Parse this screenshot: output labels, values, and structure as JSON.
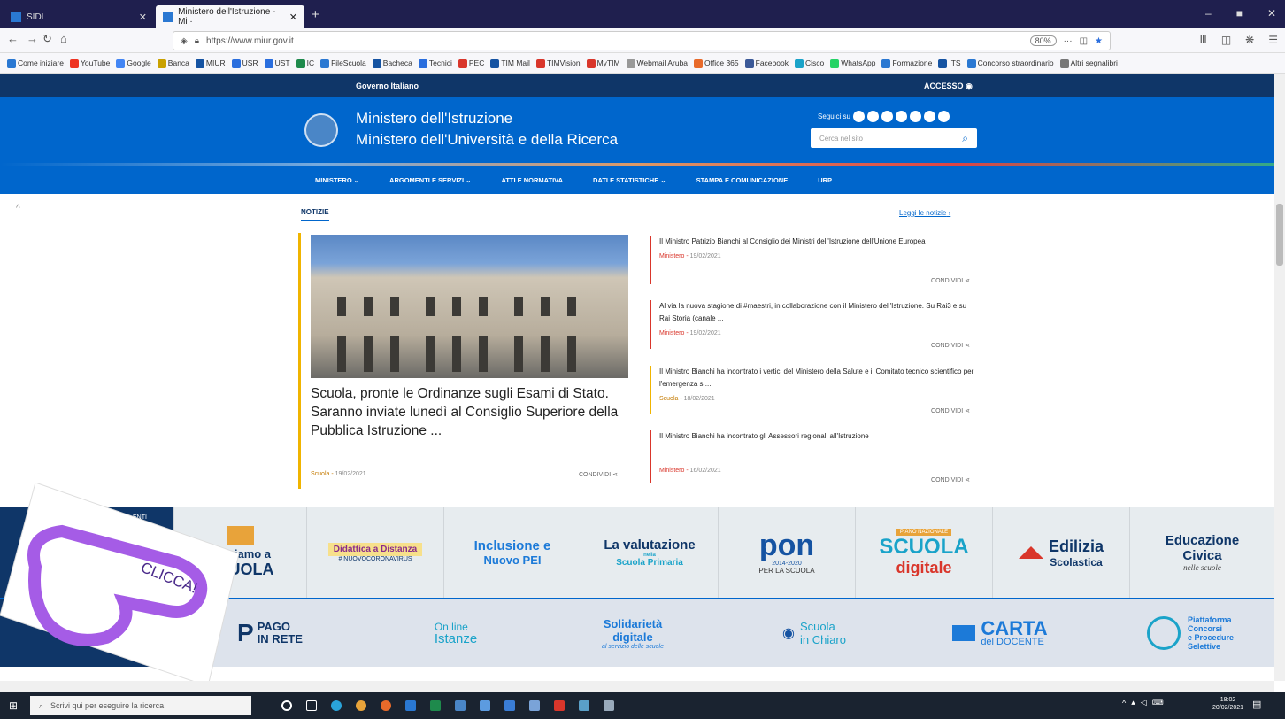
{
  "browser": {
    "tabs": [
      {
        "label": "SIDI"
      },
      {
        "label": "Ministero dell'Istruzione - Mi ·"
      }
    ],
    "new_tab": "+",
    "url": "https://www.miur.gov.it",
    "zoom": "80%",
    "bookmarks": [
      "Come iniziare",
      "YouTube",
      "Google",
      "Banca",
      "MIUR",
      "USR",
      "UST",
      "IC",
      "FileScuola",
      "Bacheca",
      "Tecnici",
      "PEC",
      "TIM Mail",
      "TIMVision",
      "MyTIM",
      "Webmail Aruba",
      "Office 365",
      "Facebook",
      "Cisco",
      "WhatsApp",
      "Formazione",
      "ITS",
      "Concorso straordinario",
      "Altri segnalibri"
    ]
  },
  "site": {
    "gov_label": "Governo Italiano",
    "access_label": "ACCESSO",
    "title_line1": "Ministero dell'Istruzione",
    "title_line2": "Ministero dell'Università e della Ricerca",
    "segui_label": "Seguici su",
    "search_placeholder": "Cerca nel sito",
    "menu": [
      "MINISTERO",
      "ARGOMENTI E SERVIZI",
      "ATTI E NORMATIVA",
      "DATI E STATISTICHE",
      "STAMPA E COMUNICAZIONE",
      "URP"
    ]
  },
  "news": {
    "section_label": "NOTIZIE",
    "read_all": "Leggi le notizie",
    "main": {
      "title": "Scuola, pronte le Ordinanze sugli Esami di Stato. Saranno inviate lunedì al Consiglio Superiore della Pubblica Istruzione ...",
      "category": "Scuola",
      "date": "19/02/2021",
      "share": "CONDIVIDI"
    },
    "items": [
      {
        "title": "Il Ministro Patrizio Bianchi al Consiglio dei Ministri dell'Istruzione dell'Unione Europea",
        "category": "Ministero",
        "date": "19/02/2021",
        "share": "CONDIVIDI"
      },
      {
        "title": "Al via la nuova stagione di #maestri, in collaborazione con il Ministero dell'Istruzione. Su Rai3 e su Rai Storia (canale ...",
        "category": "Ministero",
        "date": "19/02/2021",
        "share": "CONDIVIDI"
      },
      {
        "title": "Il Ministro Bianchi ha incontrato i vertici del Ministero della Salute e il Comitato tecnico scientifico per l'emergenza s ...",
        "category": "Scuola",
        "date": "18/02/2021",
        "share": "CONDIVIDI"
      },
      {
        "title": "Il Ministro Bianchi ha incontrato gli Assessori regionali all'Istruzione",
        "category": "Ministero",
        "date": "16/02/2021",
        "share": "CONDIVIDI"
      }
    ]
  },
  "banners_row1": {
    "side_label": "ENTI",
    "items": [
      {
        "line1": "Torniamo a",
        "line2": "SCUOLA"
      },
      {
        "line1": "Didattica a Distanza",
        "line2": "# NUOVOCORONAVIRUS"
      },
      {
        "line1": "Inclusione e",
        "line2": "Nuovo PEI"
      },
      {
        "line1": "La valutazione",
        "line2": "nella",
        "line3": "Scuola Primaria"
      },
      {
        "line1": "pon",
        "line2": "2014-2020",
        "line3": "PER LA SCUOLA"
      },
      {
        "line1": "PIANO NAZIONALE",
        "line2": "SCUOLA",
        "line3": "digitale"
      },
      {
        "line1": "Edilizia",
        "line2": "Scolastica"
      },
      {
        "line1": "Educazione",
        "line2": "Civica",
        "line3": "nelle scuole"
      }
    ]
  },
  "banners_row2": {
    "items": [
      {
        "line1": "PAGO",
        "line2": "IN RETE"
      },
      {
        "line1": "On line",
        "line2": "Istanze"
      },
      {
        "line1": "Solidarietà",
        "line2": "digitale",
        "line3": "al servizio delle scuole"
      },
      {
        "line1": "Scuola",
        "line2": "in Chiaro"
      },
      {
        "line1": "CARTA",
        "line2": "del DOCENTE"
      },
      {
        "line1": "Piattaforma",
        "line2": "Concorsi",
        "line3": "e Procedure",
        "line4": "Selettive"
      }
    ]
  },
  "overlay": {
    "label": "CLICCA!"
  },
  "taskbar": {
    "search_placeholder": "Scrivi qui per eseguire la ricerca",
    "time": "18:02",
    "date": "20/02/2021"
  }
}
